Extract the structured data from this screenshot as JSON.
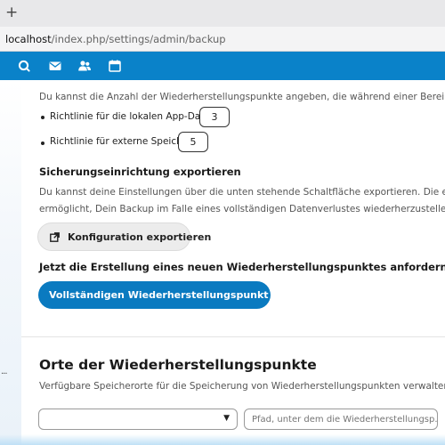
{
  "browser": {
    "new_tab_symbol": "+",
    "url_host": "localhost",
    "url_path": "/index.php/settings/admin/backup"
  },
  "nav": {
    "background": "#0a82c9",
    "icons": [
      "search-icon",
      "mail-icon",
      "contacts-icon",
      "calendar-icon"
    ]
  },
  "retention": {
    "description": "Du kannst die Anzahl der Wiederherstellungspunkte angeben, die während einer Bereinigung beibehalten werden sollen.",
    "local_label": "Richtlinie für die lokalen App-Daten:",
    "local_value": "3",
    "external_label": "Richtlinie für externe Speicher:",
    "external_value": "5"
  },
  "export": {
    "heading": "Sicherungseinrichtung exportieren",
    "desc_line1": "Du kannst deine Einstellungen über die unten stehende Schaltfläche exportieren. Die exportierte Datei",
    "desc_line2": "ermöglicht, Dein Backup im Falle eines vollständigen Datenverlustes wiederherzustellen. Bewahre sie sicher auf.",
    "button_label": "Konfiguration exportieren"
  },
  "create": {
    "heading": "Jetzt die Erstellung eines neuen Wiederherstellungspunktes anfordern",
    "button_label": "Vollständigen Wiederherstellungspunkt erstellen"
  },
  "locations": {
    "title": "Orte der Wiederherstellungspunkte",
    "description": "Verfügbare Speicherorte für die Speicherung von Wiederherstellungspunkten verwalten",
    "type_select_value": "",
    "path_placeholder": "Pfad, unter dem die Wiederherstellungsp..."
  },
  "sidebar": {
    "dots": "..."
  }
}
